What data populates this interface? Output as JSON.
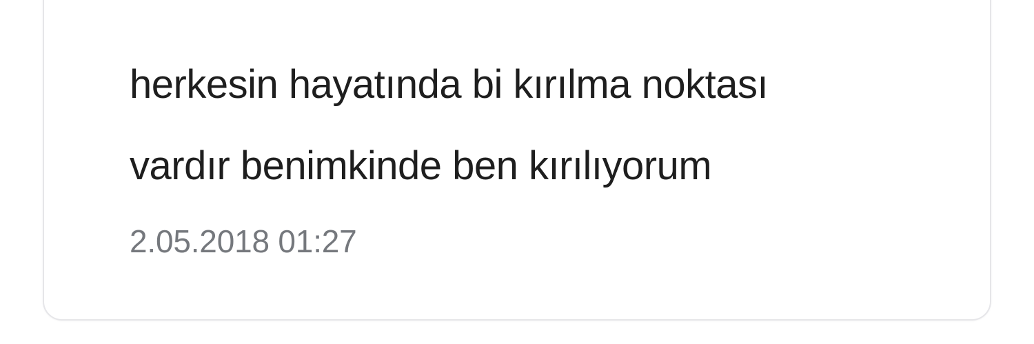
{
  "tweet": {
    "text": "herkesin hayatında bi kırılma noktası\nvardır benimkinde ben kırılıyorum",
    "timestamp": "2.05.2018 01:27"
  },
  "colors": {
    "text": "#1e1e1e",
    "timestamp": "#75787d",
    "border": "#e6e6e9",
    "avatar": "#2b1a1f"
  }
}
